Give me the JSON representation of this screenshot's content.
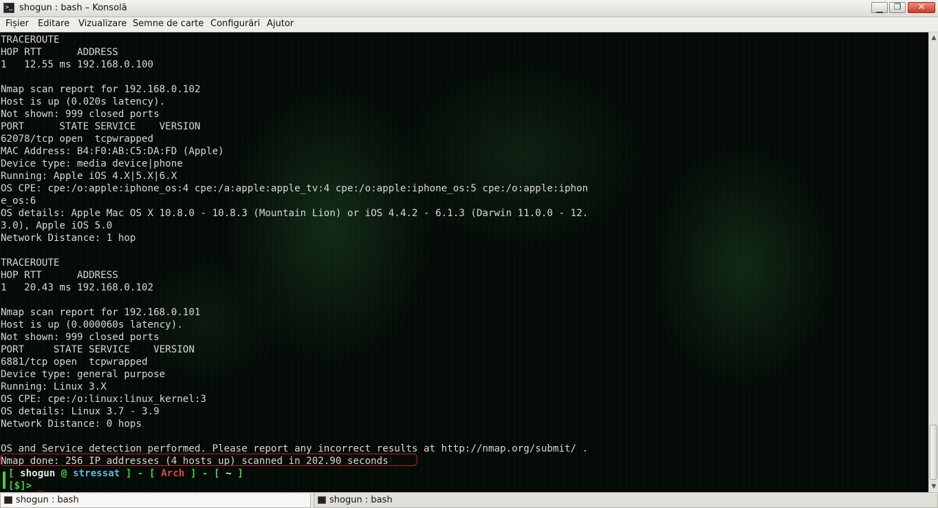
{
  "window": {
    "title": "shogun : bash – Konsolă",
    "minimize_glyph": "▁",
    "maximize_glyph": "❐",
    "close_glyph": "✕",
    "app_icon_glyph": ">_"
  },
  "menu": {
    "items": [
      "Fișier",
      "Editare",
      "Vizualizare",
      "Semne de carte",
      "Configurări",
      "Ajutor"
    ]
  },
  "terminal": {
    "lines": [
      "TRACEROUTE",
      "HOP RTT      ADDRESS",
      "1   12.55 ms 192.168.0.100",
      "",
      "Nmap scan report for 192.168.0.102",
      "Host is up (0.020s latency).",
      "Not shown: 999 closed ports",
      "PORT      STATE SERVICE    VERSION",
      "62078/tcp open  tcpwrapped",
      "MAC Address: B4:F0:AB:C5:DA:FD (Apple)",
      "Device type: media device|phone",
      "Running: Apple iOS 4.X|5.X|6.X",
      "OS CPE: cpe:/o:apple:iphone_os:4 cpe:/a:apple:apple_tv:4 cpe:/o:apple:iphone_os:5 cpe:/o:apple:iphon",
      "e_os:6",
      "OS details: Apple Mac OS X 10.8.0 - 10.8.3 (Mountain Lion) or iOS 4.4.2 - 6.1.3 (Darwin 11.0.0 - 12.",
      "3.0), Apple iOS 5.0",
      "Network Distance: 1 hop",
      "",
      "TRACEROUTE",
      "HOP RTT      ADDRESS",
      "1   20.43 ms 192.168.0.102",
      "",
      "Nmap scan report for 192.168.0.101",
      "Host is up (0.000060s latency).",
      "Not shown: 999 closed ports",
      "PORT     STATE SERVICE    VERSION",
      "6881/tcp open  tcpwrapped",
      "Device type: general purpose",
      "Running: Linux 3.X",
      "OS CPE: cpe:/o:linux:linux_kernel:3",
      "OS details: Linux 3.7 - 3.9",
      "Network Distance: 0 hops",
      "",
      "OS and Service detection performed. Please report any incorrect results at http://nmap.org/submit/ .",
      "Nmap done: 256 IP addresses (4 hosts up) scanned in 202.90 seconds"
    ],
    "prompt": {
      "open1": "[ ",
      "user": "shogun",
      "at": " @ ",
      "host": "stressat",
      "sep1": " ] - [ ",
      "distro": "Arch",
      "sep2": " ] - [ ",
      "dir": "~",
      "close": " ]",
      "symbol": "[$]> ",
      "cursor": "_"
    }
  },
  "scrollbar": {
    "up_glyph": "▲",
    "down_glyph": "▼"
  },
  "tabs": [
    {
      "label": "shogun : bash",
      "active": true
    },
    {
      "label": "shogun : bash",
      "active": false
    }
  ]
}
